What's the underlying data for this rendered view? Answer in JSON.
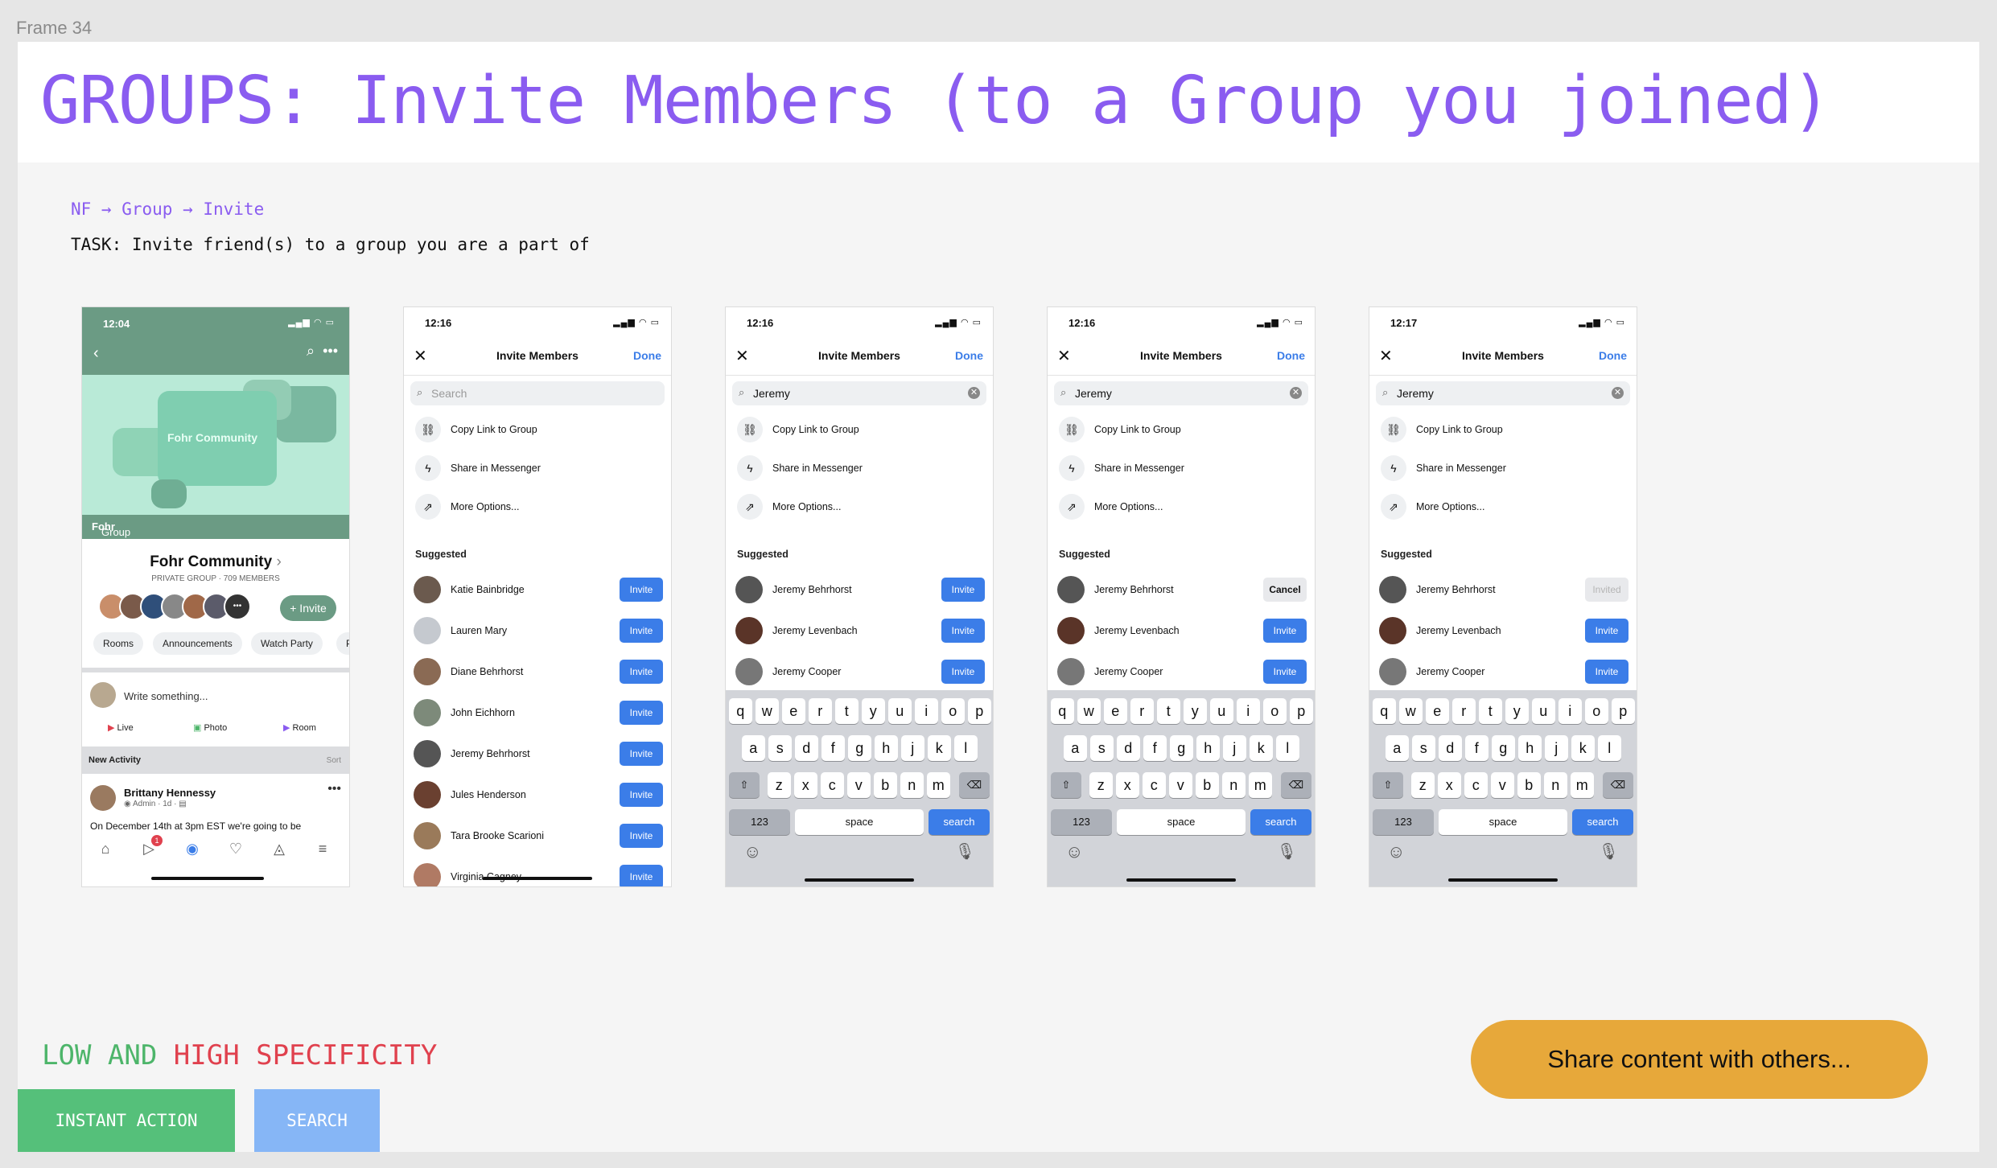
{
  "frame_label": "Frame 34",
  "title": "GROUPS: Invite Members (to a Group you joined)",
  "breadcrumb": "NF → Group → Invite",
  "task": "TASK: Invite friend(s) to a group you are a part of",
  "phone1": {
    "time": "12:04",
    "cover_text": "Fohr Community",
    "group_by_prefix": "Group by",
    "group_by_owner": "Fohr",
    "group_name": "Fohr Community",
    "group_meta": "PRIVATE GROUP · 709 MEMBERS",
    "invite_label": "+ Invite",
    "chips": [
      "Rooms",
      "Announcements",
      "Watch Party",
      "P"
    ],
    "write_placeholder": "Write something...",
    "actions": [
      "Live",
      "Photo",
      "Room"
    ],
    "new_activity": "New Activity",
    "sort": "Sort",
    "post_author": "Brittany Hennessy",
    "post_meta": "Admin · 1d ·",
    "post_text": "On December 14th at 3pm EST we're going to be",
    "notification_count": "1"
  },
  "invite_common": {
    "title": "Invite Members",
    "done": "Done",
    "options": [
      "Copy Link to Group",
      "Share in Messenger",
      "More Options..."
    ],
    "suggested": "Suggested"
  },
  "phone2": {
    "time": "12:16",
    "search_placeholder": "Search",
    "rows": [
      {
        "name": "Katie Bainbridge",
        "button": "Invite"
      },
      {
        "name": "Lauren Mary",
        "button": "Invite"
      },
      {
        "name": "Diane Behrhorst",
        "button": "Invite"
      },
      {
        "name": "John Eichhorn",
        "button": "Invite"
      },
      {
        "name": "Jeremy Behrhorst",
        "button": "Invite"
      },
      {
        "name": "Jules Henderson",
        "button": "Invite"
      },
      {
        "name": "Tara Brooke Scarioni",
        "button": "Invite"
      },
      {
        "name": "Virginia Cagney",
        "button": "Invite"
      }
    ]
  },
  "phone3": {
    "time": "12:16",
    "search_value": "Jeremy",
    "rows": [
      {
        "name": "Jeremy Behrhorst",
        "button": "Invite"
      },
      {
        "name": "Jeremy Levenbach",
        "button": "Invite"
      },
      {
        "name": "Jeremy Cooper",
        "button": "Invite"
      }
    ]
  },
  "phone4": {
    "time": "12:16",
    "search_value": "Jeremy",
    "rows": [
      {
        "name": "Jeremy Behrhorst",
        "button": "Cancel"
      },
      {
        "name": "Jeremy Levenbach",
        "button": "Invite"
      },
      {
        "name": "Jeremy Cooper",
        "button": "Invite"
      }
    ]
  },
  "phone5": {
    "time": "12:17",
    "search_value": "Jeremy",
    "rows": [
      {
        "name": "Jeremy Behrhorst",
        "button": "Invited"
      },
      {
        "name": "Jeremy Levenbach",
        "button": "Invite"
      },
      {
        "name": "Jeremy Cooper",
        "button": "Invite"
      }
    ]
  },
  "keyboard": {
    "row1": [
      "q",
      "w",
      "e",
      "r",
      "t",
      "y",
      "u",
      "i",
      "o",
      "p"
    ],
    "row2": [
      "a",
      "s",
      "d",
      "f",
      "g",
      "h",
      "j",
      "k",
      "l"
    ],
    "row3": [
      "z",
      "x",
      "c",
      "v",
      "b",
      "n",
      "m"
    ],
    "num": "123",
    "space": "space",
    "search": "search"
  },
  "specificity": {
    "low": "LOW AND",
    "high": "HIGH SPECIFICITY"
  },
  "tags": {
    "instant": "INSTANT ACTION",
    "search": "SEARCH"
  },
  "share_pill": "Share content with others...",
  "colors": {
    "accent_purple": "#8a5cf0",
    "fb_blue": "#3b7de8",
    "group_green": "#6b9b84",
    "tag_green": "#55c07a",
    "tag_blue": "#86b6f6",
    "pill_orange": "#e7a83a"
  }
}
